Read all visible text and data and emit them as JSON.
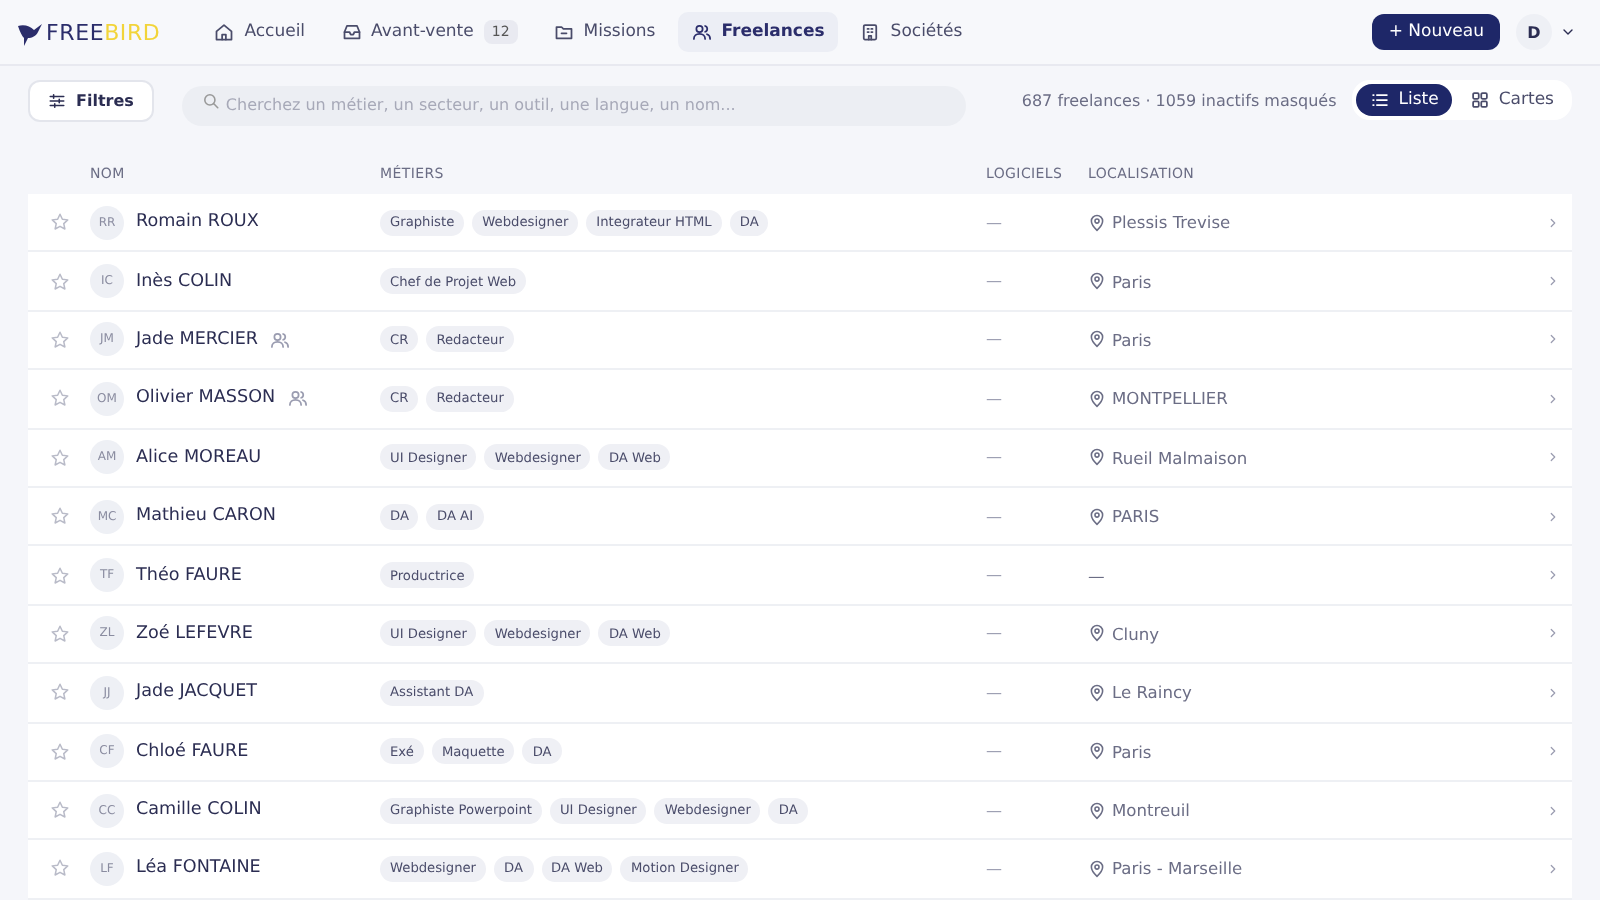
{
  "logo": {
    "parts": [
      "FREE",
      "BIRD"
    ]
  },
  "nav": [
    {
      "label": "Accueil",
      "selected": false
    },
    {
      "label": "Avant-vente",
      "badge": "12",
      "selected": false
    },
    {
      "label": "Missions",
      "selected": false
    },
    {
      "label": "Freelances",
      "selected": true
    },
    {
      "label": "Sociétés",
      "selected": false
    }
  ],
  "new_button": "+ Nouveau",
  "user": {
    "initial": "D"
  },
  "toolbar": {
    "filters": "Filtres",
    "search": {
      "placeholder": "Cherchez un métier, un secteur, un outil, une langue, un nom..."
    },
    "summary": "687 freelances · 1059 inactifs masqués",
    "views": [
      {
        "label": "Liste",
        "selected": true
      },
      {
        "label": "Cartes",
        "selected": false
      }
    ]
  },
  "table": {
    "columns": [
      "NOM",
      "MÉTIERS",
      "LOGICIELS",
      "LOCALISATION"
    ],
    "rows": [
      {
        "starred": false,
        "initials": "RR",
        "name": "Romain ROUX",
        "team": false,
        "tags": [
          "Graphiste",
          "Webdesigner",
          "Integrateur HTML",
          "DA"
        ],
        "software": "—",
        "location": "Plessis Trevise",
        "pin": true
      },
      {
        "starred": false,
        "initials": "IC",
        "name": "Inès COLIN",
        "team": false,
        "tags": [
          "Chef de Projet Web"
        ],
        "software": "—",
        "location": "Paris",
        "pin": true
      },
      {
        "starred": false,
        "initials": "JM",
        "name": "Jade MERCIER",
        "team": true,
        "tags": [
          "CR",
          "Redacteur"
        ],
        "software": "—",
        "location": "Paris",
        "pin": true
      },
      {
        "starred": false,
        "initials": "OM",
        "name": "Olivier MASSON",
        "team": true,
        "tags": [
          "CR",
          "Redacteur"
        ],
        "software": "—",
        "location": "MONTPELLIER",
        "pin": true
      },
      {
        "starred": false,
        "initials": "AM",
        "name": "Alice MOREAU",
        "team": false,
        "tags": [
          "UI Designer",
          "Webdesigner",
          "DA Web"
        ],
        "software": "—",
        "location": "Rueil Malmaison",
        "pin": true
      },
      {
        "starred": false,
        "initials": "MC",
        "name": "Mathieu CARON",
        "team": false,
        "tags": [
          "DA",
          "DA AI"
        ],
        "software": "—",
        "location": "PARIS",
        "pin": true
      },
      {
        "starred": false,
        "initials": "TF",
        "name": "Théo FAURE",
        "team": false,
        "tags": [
          "Productrice"
        ],
        "software": "—",
        "location": "—",
        "pin": false
      },
      {
        "starred": false,
        "initials": "ZL",
        "name": "Zoé LEFEVRE",
        "team": false,
        "tags": [
          "UI Designer",
          "Webdesigner",
          "DA Web"
        ],
        "software": "—",
        "location": "Cluny",
        "pin": true
      },
      {
        "starred": false,
        "initials": "JJ",
        "name": "Jade JACQUET",
        "team": false,
        "tags": [
          "Assistant DA"
        ],
        "software": "—",
        "location": "Le Raincy",
        "pin": true
      },
      {
        "starred": false,
        "initials": "CF",
        "name": "Chloé FAURE",
        "team": false,
        "tags": [
          "Exé",
          "Maquette",
          "DA"
        ],
        "software": "—",
        "location": "Paris",
        "pin": true
      },
      {
        "starred": false,
        "initials": "CC",
        "name": "Camille COLIN",
        "team": false,
        "tags": [
          "Graphiste Powerpoint",
          "UI Designer",
          "Webdesigner",
          "DA"
        ],
        "software": "—",
        "location": "Montreuil",
        "pin": true
      },
      {
        "starred": false,
        "initials": "LF",
        "name": "Léa FONTAINE",
        "team": false,
        "tags": [
          "Webdesigner",
          "DA",
          "DA Web",
          "Motion Designer"
        ],
        "software": "—",
        "location": "Paris - Marseille",
        "pin": true
      }
    ]
  }
}
